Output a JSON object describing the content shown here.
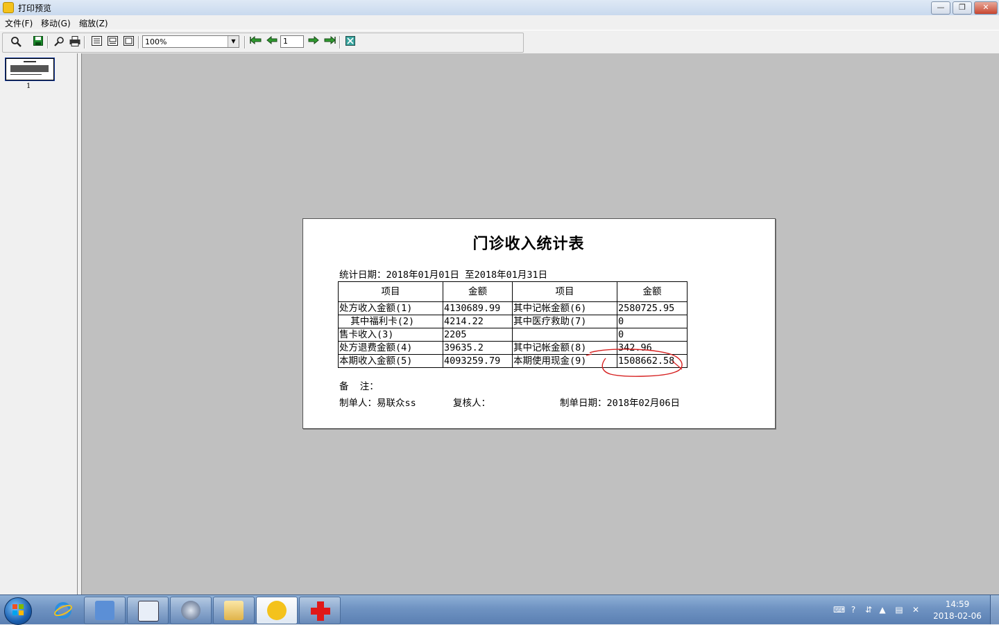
{
  "window": {
    "title": "打印预览",
    "controls": {
      "minimize": "—",
      "restore": "❐",
      "close": "✕"
    }
  },
  "menu": [
    "文件(F)",
    "移动(G)",
    "缩放(Z)"
  ],
  "toolbar": {
    "zoom_value": "100%",
    "page_number": "1",
    "icons": [
      "magnifier-icon",
      "save-icon",
      "find-icon",
      "print-icon",
      "one-page-icon",
      "two-page-icon",
      "multi-page-icon",
      "first-page-icon",
      "prev-page-icon",
      "next-page-icon",
      "last-page-icon",
      "close-preview-icon"
    ]
  },
  "thumbnail": {
    "page_label": "1"
  },
  "report": {
    "title": "门诊收入统计表",
    "date_range": "统计日期：2018年01月01日 至2018年01月31日",
    "headers": [
      "项目",
      "金额",
      "项目",
      "金额"
    ],
    "rows": [
      [
        "处方收入金额(1)",
        "4130689.99",
        "其中记帐金额(6)",
        "2580725.95"
      ],
      [
        "  其中福利卡(2)",
        "4214.22",
        "其中医疗救助(7)",
        "0"
      ],
      [
        "售卡收入(3)",
        "2205",
        "",
        "0"
      ],
      [
        "处方退费金额(4)",
        "39635.2",
        "其中记帐金额(8)",
        "342.96"
      ],
      [
        "本期收入金额(5)",
        "4093259.79",
        "本期使用现金(9)",
        "1508662.58"
      ]
    ],
    "remark": "备  注：",
    "maker": "制单人：易联众ss",
    "checker": "复核人：",
    "make_date": "制单日期：2018年02月06日"
  },
  "taskbar": {
    "apps": [
      "ie-icon",
      "remote-desktop-icon",
      "sql-icon",
      "compass-icon",
      "file-explorer-icon",
      "print-app-icon",
      "medical-cross-icon"
    ],
    "time": "14:59",
    "date": "2018-02-06"
  },
  "colors": {
    "annotation": "#d62020",
    "preview_bg": "#c0c0c0"
  }
}
